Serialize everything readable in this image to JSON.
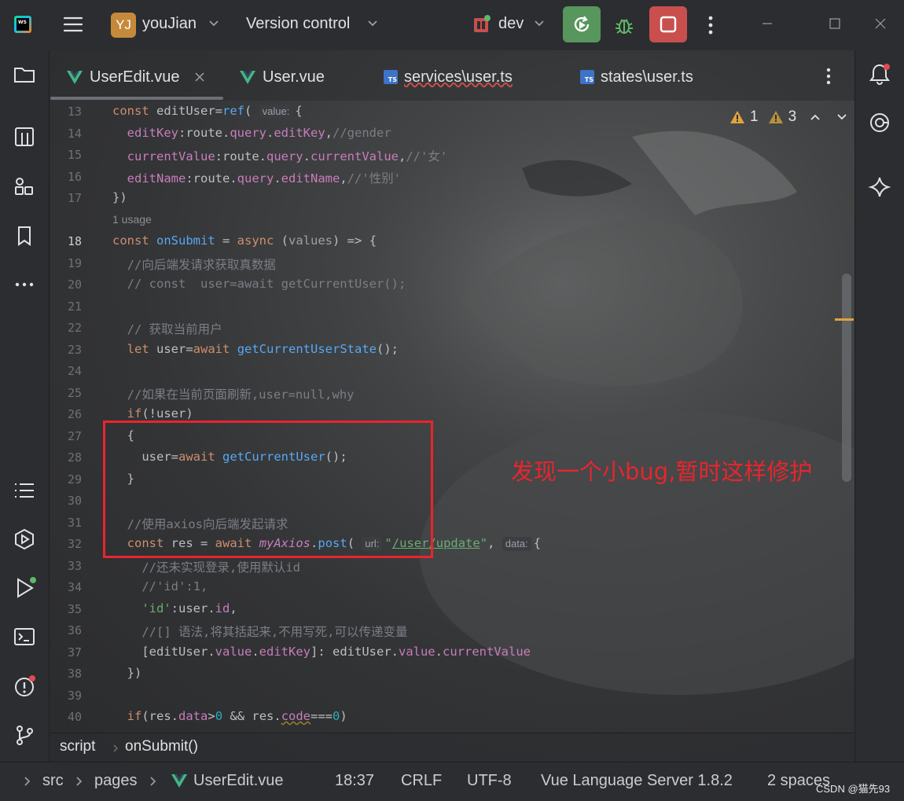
{
  "titlebar": {
    "project_badge": "YJ",
    "project_name": "youJian",
    "vcs_label": "Version control",
    "branch": "dev"
  },
  "tabs": [
    {
      "label": "UserEdit.vue",
      "kind": "vue",
      "active": true
    },
    {
      "label": "User.vue",
      "kind": "vue"
    },
    {
      "label": "services\\user.ts",
      "kind": "ts"
    },
    {
      "label": "states\\user.ts",
      "kind": "ts"
    }
  ],
  "inspections": {
    "warnings_a": "1",
    "warnings_b": "3"
  },
  "editor": {
    "usage_hint": "1 usage",
    "hint_value": "value:",
    "hint_url": "url:",
    "hint_data": "data:",
    "annotation": "发现一个小bug,暂时这样修护",
    "line_numbers": [
      "13",
      "14",
      "15",
      "16",
      "17",
      "18",
      "19",
      "20",
      "21",
      "22",
      "23",
      "24",
      "25",
      "26",
      "27",
      "28",
      "29",
      "30",
      "31",
      "32",
      "33",
      "34",
      "35",
      "36",
      "37",
      "38",
      "39",
      "40"
    ]
  },
  "breadcrumb": {
    "part1": "script",
    "part2": "onSubmit()"
  },
  "statusbar": {
    "path1": "src",
    "path2": "pages",
    "path3": "UserEdit.vue",
    "position": "18:37",
    "line_sep": "CRLF",
    "encoding": "UTF-8",
    "language_server": "Vue Language Server 1.8.2",
    "indent": "2 spaces"
  },
  "watermark": "CSDN @猫先93",
  "colors": {
    "accent_run": "#57965c",
    "accent_stop": "#c94f4f",
    "annotation": "#e8252d"
  }
}
